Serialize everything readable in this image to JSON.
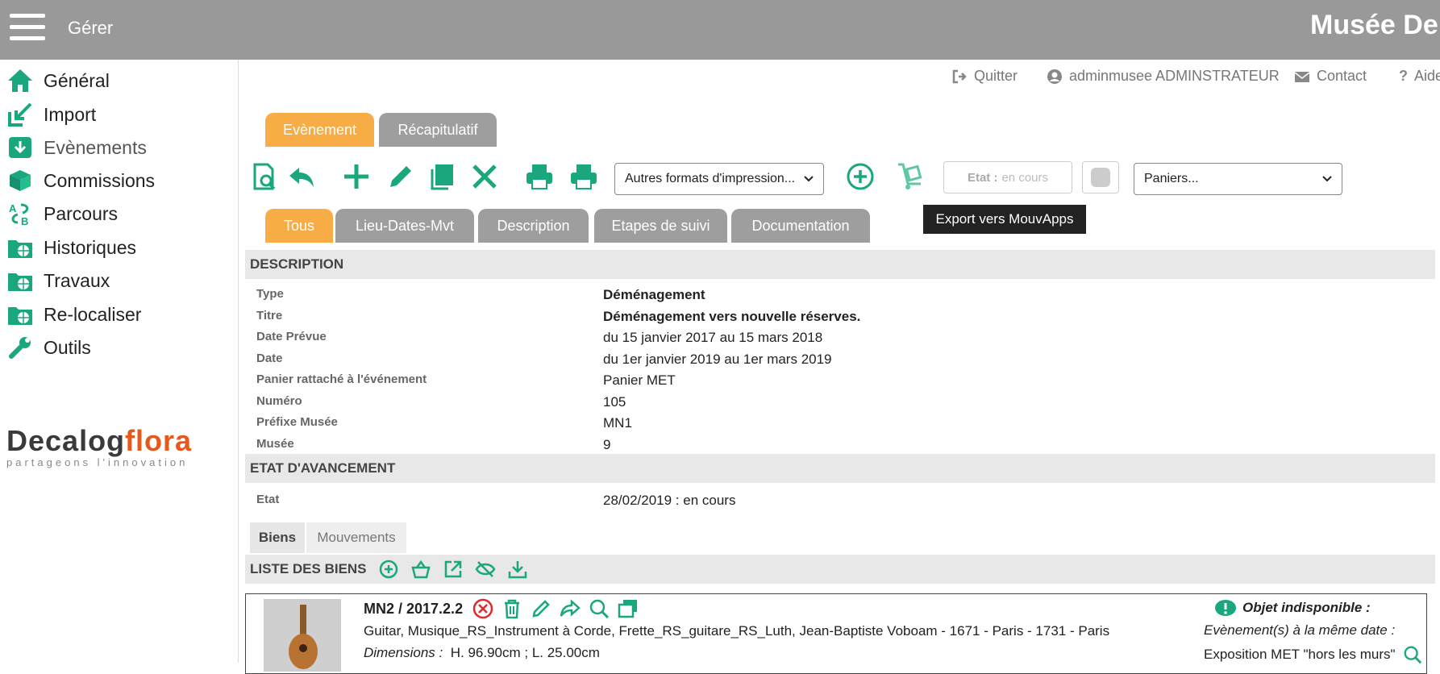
{
  "header": {
    "menu_label": "Gérer",
    "brand": "Musée De"
  },
  "sidebar": {
    "items": [
      {
        "label": "Général",
        "icon": "home-icon"
      },
      {
        "label": "Import",
        "icon": "import-icon"
      },
      {
        "label": "Evènements",
        "icon": "events-icon"
      },
      {
        "label": "Commissions",
        "icon": "commissions-icon"
      },
      {
        "label": "Parcours",
        "icon": "parcours-icon"
      },
      {
        "label": "Historiques",
        "icon": "historiques-icon"
      },
      {
        "label": "Travaux",
        "icon": "travaux-icon"
      },
      {
        "label": "Re-localiser",
        "icon": "relocaliser-icon"
      },
      {
        "label": "Outils",
        "icon": "wrench-icon"
      }
    ],
    "logo_main_a": "Decalog",
    "logo_main_b": "flora",
    "logo_sub": "partageons l'innovation"
  },
  "user_links": {
    "quit": "Quitter",
    "user": "adminmusee ADMINSTRATEUR",
    "contact": "Contact",
    "help": "Aide"
  },
  "main_tabs": [
    "Evènement",
    "Récapitulatif"
  ],
  "toolbar": {
    "print_formats": "Autres formats d'impression...",
    "etat_label": "Etat :",
    "etat_value": "en cours",
    "paniers": "Paniers...",
    "tooltip": "Export vers MouvApps"
  },
  "sub_tabs": [
    "Tous",
    "Lieu-Dates-Mvt",
    "Description",
    "Etapes de suivi",
    "Documentation"
  ],
  "description": {
    "title": "DESCRIPTION",
    "rows": [
      {
        "k": "Type",
        "v": "Déménagement"
      },
      {
        "k": "Titre",
        "v": "Déménagement vers nouvelle réserves."
      },
      {
        "k": "Date Prévue",
        "v": "du 15 janvier 2017 au 15 mars 2018"
      },
      {
        "k": "Date",
        "v": "du 1er janvier 2019 au 1er mars 2019"
      },
      {
        "k": "Panier rattaché à l'événement",
        "v": "Panier MET"
      },
      {
        "k": "Numéro",
        "v": "105"
      },
      {
        "k": "Préfixe Musée",
        "v": "MN1"
      },
      {
        "k": "Musée",
        "v": "9"
      }
    ]
  },
  "avancement": {
    "title": "ETAT D'AVANCEMENT",
    "etat_key": "Etat",
    "etat_value": "28/02/2019 : en cours"
  },
  "inner_tabs": [
    "Biens",
    "Mouvements"
  ],
  "list": {
    "title": "LISTE DES BIENS",
    "item": {
      "ref": "MN2 / 2017.2.2",
      "desc": "Guitar, Musique_RS_Instrument à Corde, Frette_RS_guitare_RS_Luth, Jean-Baptiste Voboam - 1671 - Paris - 1731 - Paris",
      "dims_label": "Dimensions :",
      "dims_value": "H. 96.90cm ; L. 25.00cm",
      "unavailable": "Objet indisponible :",
      "same_date": "Evènement(s) à la même date :",
      "expo": "Exposition MET \"hors les murs\""
    }
  },
  "colors": {
    "accent_green": "#1aa77e",
    "tab_orange": "#f8ac46",
    "tab_grey": "#9e9e9e",
    "header_grey": "#999999"
  }
}
